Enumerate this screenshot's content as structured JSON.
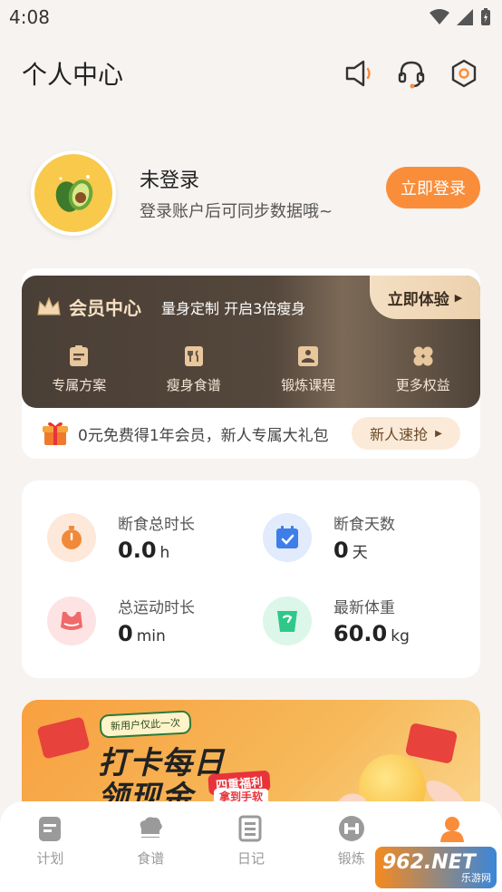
{
  "status_bar": {
    "time": "4:08"
  },
  "header": {
    "title": "个人中心"
  },
  "profile": {
    "name": "未登录",
    "subtitle": "登录账户后可同步数据哦~",
    "login_button": "立即登录"
  },
  "vip": {
    "title": "会员中心",
    "slogan": "量身定制 开启3倍瘦身",
    "try_button": "立即体验",
    "features": [
      {
        "label": "专属方案",
        "icon": "plan-icon"
      },
      {
        "label": "瘦身食谱",
        "icon": "recipe-book-icon"
      },
      {
        "label": "锻炼课程",
        "icon": "course-icon"
      },
      {
        "label": "更多权益",
        "icon": "clover-icon"
      }
    ],
    "promo_text": "0元免费得1年会员，新人专属大礼包",
    "promo_button": "新人速抢"
  },
  "stats": [
    {
      "label": "断食总时长",
      "value": "0.0",
      "unit": "h",
      "icon": "stopwatch-icon",
      "color": "#f08a3a"
    },
    {
      "label": "断食天数",
      "value": "0",
      "unit": "天",
      "icon": "calendar-check-icon",
      "color": "#3d7ee8"
    },
    {
      "label": "总运动时长",
      "value": "0",
      "unit": "min",
      "icon": "sports-bra-icon",
      "color": "#f06a6a"
    },
    {
      "label": "最新体重",
      "value": "60.0",
      "unit": "kg",
      "icon": "scale-icon",
      "color": "#2fc88a"
    }
  ],
  "banner": {
    "tag": "新用户仅此一次",
    "line1": "打卡每日",
    "line2": "领现金",
    "pill": "四重福利",
    "pill2": "拿到手软"
  },
  "tabs": [
    {
      "label": "计划",
      "icon": "plan-tab-icon"
    },
    {
      "label": "食谱",
      "icon": "chef-hat-icon"
    },
    {
      "label": "日记",
      "icon": "diary-icon"
    },
    {
      "label": "锻炼",
      "icon": "dumbbell-icon"
    },
    {
      "label": "",
      "icon": "user-icon"
    }
  ],
  "watermark": {
    "brand": "962.NET",
    "sub": "乐游网"
  },
  "colors": {
    "accent": "#f98d3a",
    "background": "#f6f3f1",
    "vip_dark": "#4a3f36"
  }
}
